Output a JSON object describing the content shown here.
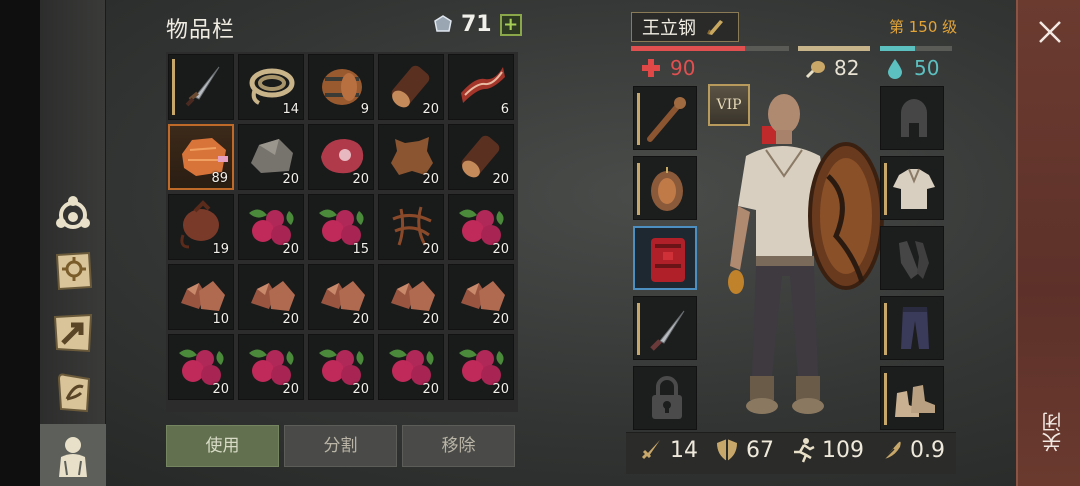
{
  "left_menu": {
    "items": [
      {
        "name": "crafting-icon"
      },
      {
        "name": "recipes-book-icon"
      },
      {
        "name": "map-icon"
      },
      {
        "name": "quest-scroll-icon"
      },
      {
        "name": "character-icon"
      }
    ]
  },
  "inventory": {
    "title": "物品栏",
    "currency_value": "71",
    "plus_label": "+",
    "slots": [
      {
        "item": "dagger",
        "count": ""
      },
      {
        "item": "rope",
        "count": "14"
      },
      {
        "item": "barrel",
        "count": "9"
      },
      {
        "item": "log",
        "count": "20"
      },
      {
        "item": "bacon",
        "count": "6"
      },
      {
        "item": "copper-ore",
        "count": "89"
      },
      {
        "item": "stone",
        "count": "20"
      },
      {
        "item": "raw-meat",
        "count": "20"
      },
      {
        "item": "leather",
        "count": "20"
      },
      {
        "item": "log",
        "count": "20"
      },
      {
        "item": "waterskin",
        "count": "19"
      },
      {
        "item": "berries",
        "count": "20"
      },
      {
        "item": "berries",
        "count": "15"
      },
      {
        "item": "fibers",
        "count": "20"
      },
      {
        "item": "berries",
        "count": "20"
      },
      {
        "item": "iron-ore",
        "count": "10"
      },
      {
        "item": "iron-ore",
        "count": "20"
      },
      {
        "item": "iron-ore",
        "count": "20"
      },
      {
        "item": "iron-ore",
        "count": "20"
      },
      {
        "item": "iron-ore",
        "count": "20"
      },
      {
        "item": "berries",
        "count": "20"
      },
      {
        "item": "berries",
        "count": "20"
      },
      {
        "item": "berries",
        "count": "20"
      },
      {
        "item": "berries",
        "count": "20"
      },
      {
        "item": "berries",
        "count": "20"
      }
    ],
    "actions": {
      "use": "使用",
      "split": "分割",
      "remove": "移除"
    }
  },
  "character": {
    "name": "王立钢",
    "level": "第 150 级",
    "health": "90",
    "food": "82",
    "water": "50",
    "health_fill": 0.72,
    "food_fill": 1.0,
    "water_fill": 0.48,
    "vip_label": "VIP",
    "stats": {
      "attack": "14",
      "defense": "67",
      "speed": "109",
      "weight": "0.9"
    }
  },
  "colors": {
    "health": "#e05050",
    "food": "#c8b48a",
    "water": "#5cc0c0",
    "level": "#e3a437"
  },
  "close": {
    "symbol": "✕",
    "label": "关闭"
  }
}
